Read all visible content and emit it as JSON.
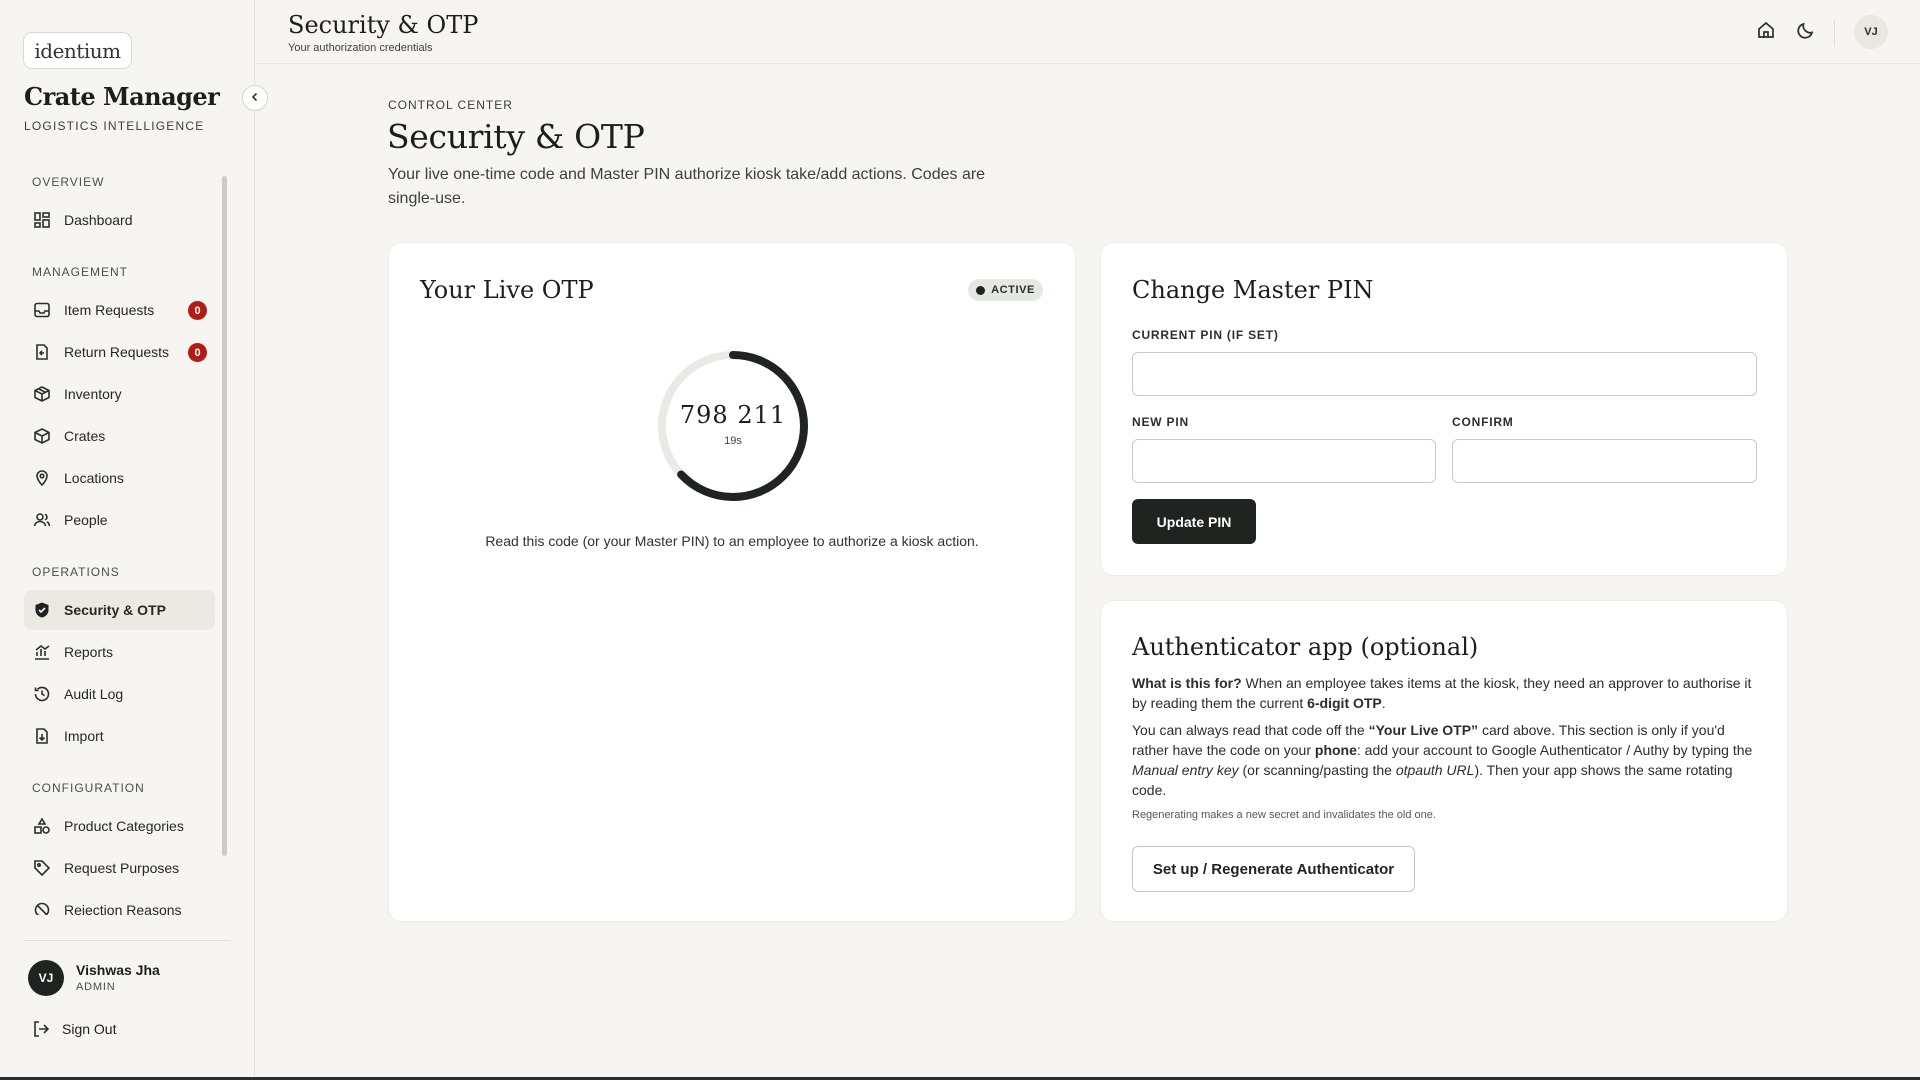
{
  "brand": {
    "logo_text": "identium",
    "title": "Crate Manager",
    "subtitle": "LOGISTICS INTELLIGENCE"
  },
  "sidebar": {
    "sections": [
      {
        "label": "OVERVIEW",
        "items": [
          {
            "label": "Dashboard",
            "icon": "dashboard-icon"
          }
        ]
      },
      {
        "label": "MANAGEMENT",
        "items": [
          {
            "label": "Item Requests",
            "icon": "inbox-icon",
            "badge": "0"
          },
          {
            "label": "Return Requests",
            "icon": "return-icon",
            "badge": "0"
          },
          {
            "label": "Inventory",
            "icon": "box-icon"
          },
          {
            "label": "Crates",
            "icon": "crate-icon"
          },
          {
            "label": "Locations",
            "icon": "map-pin-icon"
          },
          {
            "label": "People",
            "icon": "people-icon"
          }
        ]
      },
      {
        "label": "OPERATIONS",
        "items": [
          {
            "label": "Security & OTP",
            "icon": "shield-icon",
            "active": true
          },
          {
            "label": "Reports",
            "icon": "chart-icon"
          },
          {
            "label": "Audit Log",
            "icon": "history-icon"
          },
          {
            "label": "Import",
            "icon": "import-icon"
          }
        ]
      },
      {
        "label": "CONFIGURATION",
        "items": [
          {
            "label": "Product Categories",
            "icon": "shapes-icon"
          },
          {
            "label": "Request Purposes",
            "icon": "tag-icon"
          },
          {
            "label": "Rejection Reasons",
            "icon": "ban-icon"
          }
        ]
      }
    ],
    "user": {
      "initials": "VJ",
      "name": "Vishwas Jha",
      "role": "ADMIN"
    },
    "sign_out": "Sign Out"
  },
  "topbar": {
    "title": "Security & OTP",
    "subtitle": "Your authorization credentials",
    "avatar_initials": "VJ"
  },
  "page": {
    "eyebrow": "CONTROL CENTER",
    "title": "Security & OTP",
    "description": "Your live one-time code and Master PIN authorize kiosk take/add actions. Codes are single-use."
  },
  "otp_card": {
    "title": "Your Live OTP",
    "status": "ACTIVE",
    "code": "798 211",
    "seconds_left": "19s",
    "ring_fraction": 0.63,
    "help": "Read this code (or your Master PIN) to an employee to authorize a kiosk action."
  },
  "pin_card": {
    "title": "Change Master PIN",
    "current_label": "CURRENT PIN (IF SET)",
    "new_label": "NEW PIN",
    "confirm_label": "CONFIRM",
    "current_value": "",
    "new_value": "",
    "confirm_value": "",
    "button": "Update PIN"
  },
  "auth_card": {
    "title": "Authenticator app (optional)",
    "p1_strong": "What is this for?",
    "p1_a": " When an employee takes items at the kiosk, they need an approver to authorise it by reading them the current ",
    "p1_b": "6-digit OTP",
    "p1_c": ".",
    "p2_a": "You can always read that code off the ",
    "p2_b": "“Your Live OTP”",
    "p2_c": " card above. This section is only if you'd rather have the code on your ",
    "p2_d": "phone",
    "p2_e": ": add your account to Google Authenticator / Authy by typing the ",
    "p2_f": "Manual entry key",
    "p2_g": " (or scanning/pasting the ",
    "p2_h": "otpauth URL",
    "p2_i": "). Then your app shows the same rotating code.",
    "note": "Regenerating makes a new secret and invalidates the old one.",
    "button": "Set up / Regenerate Authenticator"
  },
  "colors": {
    "accent": "#1f2420",
    "badge": "#b31b17",
    "ring_track": "#ebe9e6"
  }
}
